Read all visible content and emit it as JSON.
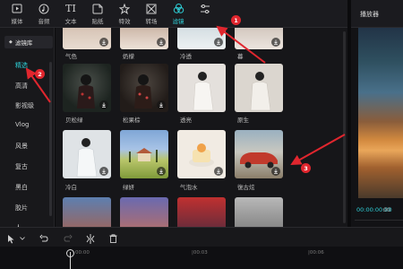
{
  "toolbar": {
    "tools": [
      {
        "label": "媒体",
        "icon": "media-icon"
      },
      {
        "label": "音频",
        "icon": "audio-icon"
      },
      {
        "label": "文本",
        "icon": "text-icon"
      },
      {
        "label": "贴纸",
        "icon": "sticker-icon"
      },
      {
        "label": "特效",
        "icon": "effects-icon"
      },
      {
        "label": "转场",
        "icon": "transition-icon"
      },
      {
        "label": "滤镜",
        "icon": "filter-icon"
      },
      {
        "label": "",
        "icon": "adjust-icon"
      }
    ],
    "active_tool": "滤镜"
  },
  "player": {
    "title": "播放器",
    "timecode": "00:00:00:00",
    "timecode_total": "00"
  },
  "categories": {
    "header": "滤镜库",
    "items": [
      "精选",
      "高清",
      "影视级",
      "Vlog",
      "风景",
      "复古",
      "黑白",
      "胶片",
      "人"
    ],
    "active": "精选"
  },
  "filters": {
    "row1": [
      "气色",
      "奶檬",
      "冷透",
      "暮"
    ],
    "row2": [
      "贝松绿",
      "松果棕",
      "透亮",
      "原生"
    ],
    "row3": [
      "冷白",
      "绿妍",
      "气泡水",
      "復古炫"
    ],
    "row4": [
      "",
      "",
      "",
      ""
    ]
  },
  "timeline": {
    "ticks": [
      "00:00",
      "|00:03",
      "|00:06"
    ]
  },
  "annotations": [
    "1",
    "2",
    "3"
  ],
  "colors": {
    "accent": "#2fd1d9",
    "annotation": "#e0262e"
  }
}
